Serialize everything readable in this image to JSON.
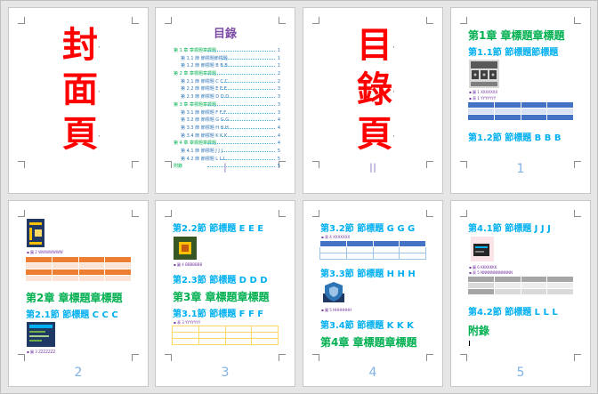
{
  "pages": [
    {
      "kind": "cover",
      "big_text": [
        "封",
        "面",
        "頁"
      ]
    },
    {
      "kind": "toc",
      "title": "目錄",
      "page_number": "I",
      "entries": [
        {
          "text": "第 1 章  章標題章標題",
          "page": "1",
          "level": 1
        },
        {
          "text": "第 1.1 節  節標題節標題",
          "page": "1",
          "level": 2
        },
        {
          "text": "第 1.2 節  節標題 B B B",
          "page": "1",
          "level": 2
        },
        {
          "text": "第 2 章  章標題章標題",
          "page": "2",
          "level": 1
        },
        {
          "text": "第 2.1 節  節標題 C C C",
          "page": "2",
          "level": 2
        },
        {
          "text": "第 2.2 節  節標題 E E E",
          "page": "3",
          "level": 2
        },
        {
          "text": "第 2.3 節  節標題 D D D",
          "page": "3",
          "level": 2
        },
        {
          "text": "第 3 章  章標題章標題",
          "page": "3",
          "level": 1
        },
        {
          "text": "第 3.1 節  節標題 F F F",
          "page": "3",
          "level": 2
        },
        {
          "text": "第 3.2 節  節標題 G G G",
          "page": "4",
          "level": 2
        },
        {
          "text": "第 3.3 節  節標題 H H H",
          "page": "4",
          "level": 2
        },
        {
          "text": "第 3.4 節  節標題 K K K",
          "page": "4",
          "level": 2
        },
        {
          "text": "第 4 章  章標題章標題",
          "page": "4",
          "level": 1
        },
        {
          "text": "第 4.1 節  節標題 J J J",
          "page": "5",
          "level": 2
        },
        {
          "text": "第 4.2 節  節標題 L L L",
          "page": "5",
          "level": 2
        },
        {
          "text": "附錄",
          "page": "5",
          "level": 1
        }
      ]
    },
    {
      "kind": "toc-cover",
      "big_text": [
        "目",
        "錄",
        "頁"
      ],
      "page_number": "II"
    },
    {
      "kind": "content",
      "page_number": "1",
      "items": {
        "ch1": "第1章 章標題章標題",
        "s11": "第1.1節 節標題節標題",
        "fig_cap": "圖 1 XXXXXXX",
        "tbl_cap": "表 1 YYYYYYY",
        "s12": "第1.2節 節標題 B B B"
      }
    },
    {
      "kind": "content",
      "page_number": "2",
      "items": {
        "fig2_cap": "圖 2 WWWWWWW",
        "ch2": "第2章 章標題章標題",
        "s21": "第2.1節 節標題 C C C",
        "fig3_cap": "圖 3 ZZZZZZZ"
      }
    },
    {
      "kind": "content",
      "page_number": "3",
      "items": {
        "s22": "第2.2節 節標題 E E E",
        "fig4_cap": "圖 4 BBBBBBB",
        "s23": "第2.3節 節標題 D D D",
        "ch3": "第3章 章標題章標題",
        "s31": "第3.1節 節標題 F F F",
        "tbl3_cap": "表 3 YYYYYYY"
      }
    },
    {
      "kind": "content",
      "page_number": "4",
      "items": {
        "s32": "第3.2節 節標題 G G G",
        "tbl4_cap": "表 4 XXXXXXX",
        "s33": "第3.3節 節標題 H H H",
        "fig5_cap": "圖 5 HHHHHHH",
        "s34": "第3.4節 節標題 K K K",
        "ch4": "第4章 章標題章標題"
      }
    },
    {
      "kind": "content",
      "page_number": "5",
      "items": {
        "s41": "第4.1節 節標題 J J J",
        "fig6_cap": "圖 6 KKKKKKK",
        "tbl5_cap": "表 5 NNNNNNNNNNNN",
        "s42": "第4.2節 節標題 L L L",
        "appx": "附錄"
      }
    }
  ],
  "colors": {
    "cover_red": "#ff0000",
    "chapter_green": "#00b050",
    "section_cyan": "#00b0f0",
    "toc_purple": "#7d4ea6",
    "roman_page_num": "#b4a7d6",
    "arabic_page_num": "#7fb2e5"
  }
}
